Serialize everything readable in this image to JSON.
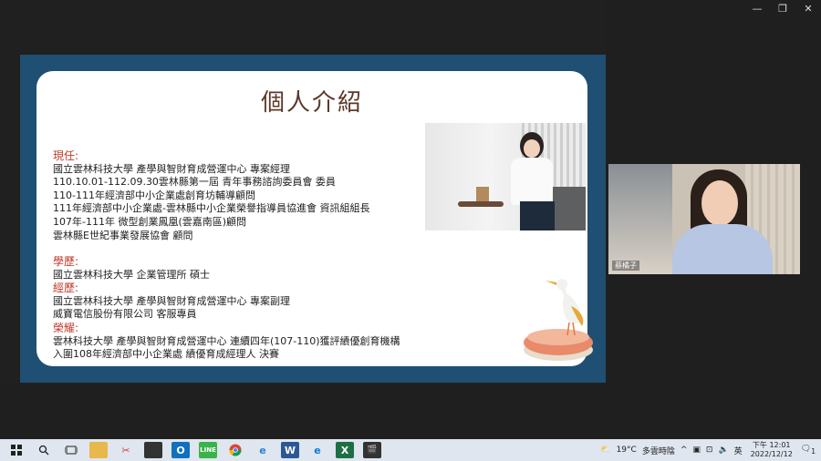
{
  "window": {
    "minimize": "—",
    "restore": "❐",
    "close": "✕"
  },
  "slide": {
    "title": "個人介紹",
    "current_heading": "現任:",
    "current": [
      "國立雲林科技大學 產學與智財育成營運中心 專案經理",
      "110.10.01-112.09.30雲林縣第一屆 青年事務諮詢委員會 委員",
      "110-111年經濟部中小企業處創育坊輔導顧問",
      "111年經濟部中小企業處-雲林縣中小企業榮譽指導員協進會 資訊組組長",
      "107年-111年 微型創業鳳凰(雲嘉南區)顧問",
      "雲林縣E世紀事業發展協會 顧問"
    ],
    "edu_heading": "學歷:",
    "edu": [
      "國立雲林科技大學 企業管理所 碩士"
    ],
    "exp_heading": "經歷:",
    "exp": [
      "國立雲林科技大學 產學與智財育成營運中心 專案副理",
      "威寶電信股份有限公司 客服專員"
    ],
    "honor_heading": "榮耀:",
    "honor": [
      "雲林科技大學 產學與智財育成營運中心 連續四年(107-110)獲評績優創育機構",
      "入圍108年經濟部中小企業處 績優育成經理人 決賽"
    ]
  },
  "participant": {
    "name": "蔡橘子"
  },
  "taskbar": {
    "apps": [
      "windows-start",
      "search",
      "task-view",
      "file-explorer",
      "snipping",
      "sticky",
      "outlook",
      "line",
      "chrome",
      "ie",
      "word",
      "edge",
      "excel",
      "clapper"
    ],
    "weather_temp": "19°C",
    "weather_desc": "多雲時陰",
    "lang": "英",
    "time": "下午 12:01",
    "date": "2022/12/12",
    "notif_count": "1"
  },
  "colors": {
    "frame": "#1f4f73",
    "heading": "#c0392b",
    "title": "#5b3a2a"
  }
}
